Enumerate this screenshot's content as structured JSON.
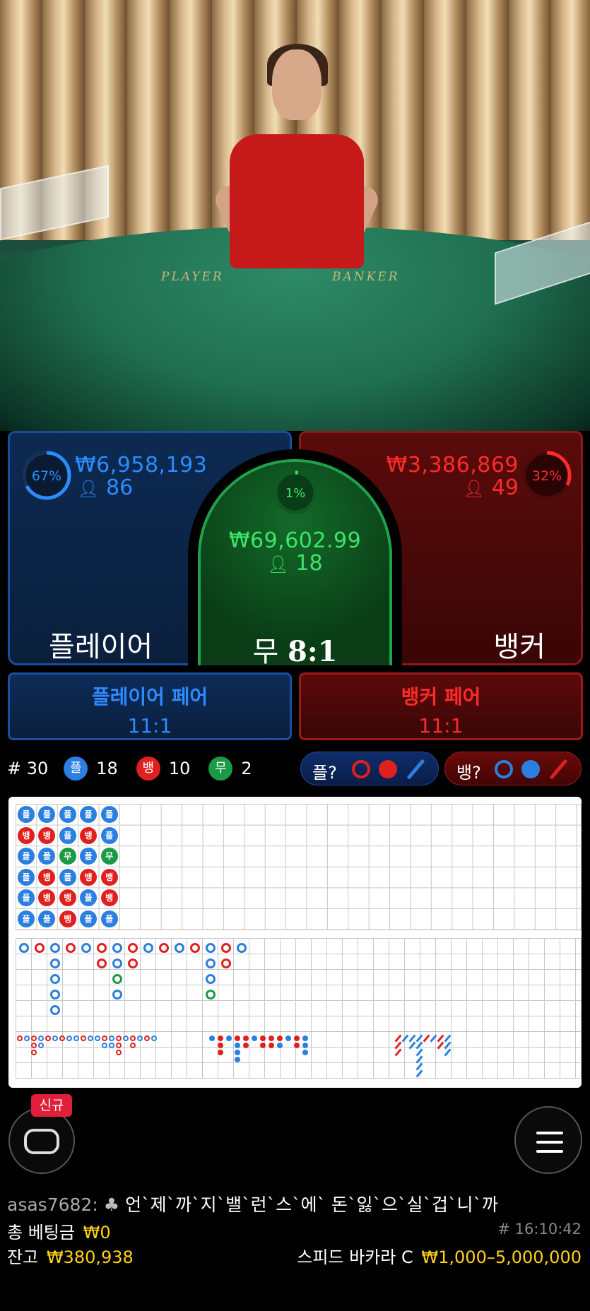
{
  "video": {
    "felt_left": "PLAYER",
    "felt_right": "BANKER"
  },
  "bets": {
    "player": {
      "label": "플레이어",
      "amount": "₩6,958,193",
      "players": "86",
      "percent_text": "67%",
      "percent": 0.67
    },
    "tie": {
      "label": "무",
      "payout": "8:1",
      "amount": "₩69,602.99",
      "players": "18",
      "percent_text": "1%",
      "percent": 0.01
    },
    "banker": {
      "label": "뱅커",
      "amount": "₩3,386,869",
      "players": "49",
      "percent_text": "32%",
      "percent": 0.32
    }
  },
  "pairs": {
    "player": {
      "title": "플레이어 페어",
      "odds": "11:1"
    },
    "banker": {
      "title": "뱅커 페어",
      "odds": "11:1"
    }
  },
  "stats": {
    "round_label": "# 30",
    "player_chip": "플",
    "player_count": "18",
    "banker_chip": "뱅",
    "banker_count": "10",
    "tie_chip": "무",
    "tie_count": "2",
    "ask_player": "플?",
    "ask_banker": "뱅?"
  },
  "colors": {
    "player": "#2a7fe0",
    "banker": "#e0201e",
    "tie": "#1a9a46",
    "gold": "#ffd21a"
  },
  "bead_road": [
    [
      "플",
      "뱅",
      "플",
      "플",
      "플",
      "플"
    ],
    [
      "플",
      "뱅",
      "플",
      "뱅",
      "뱅",
      "플"
    ],
    [
      "플",
      "플",
      "무",
      "플",
      "뱅",
      "뱅"
    ],
    [
      "플",
      "뱅",
      "플",
      "뱅",
      "플",
      "플"
    ],
    [
      "플",
      "플",
      "무",
      "뱅",
      "뱅",
      "플"
    ]
  ],
  "bottom": {
    "new_badge": "신규",
    "chat_user": "asas7682:",
    "chat_icon": "club-icon",
    "chat_message": "언`제`까`지`밸`런`스`에` 돈`잃`으`실`겁`니`까",
    "total_bet_label": "총 베팅금",
    "total_bet_value": "₩0",
    "round_time": "# 16:10:42",
    "balance_label": "잔고",
    "balance_value": "₩380,938",
    "table_name": "스피드 바카라 C",
    "limits": "₩1,000–5,000,000"
  }
}
